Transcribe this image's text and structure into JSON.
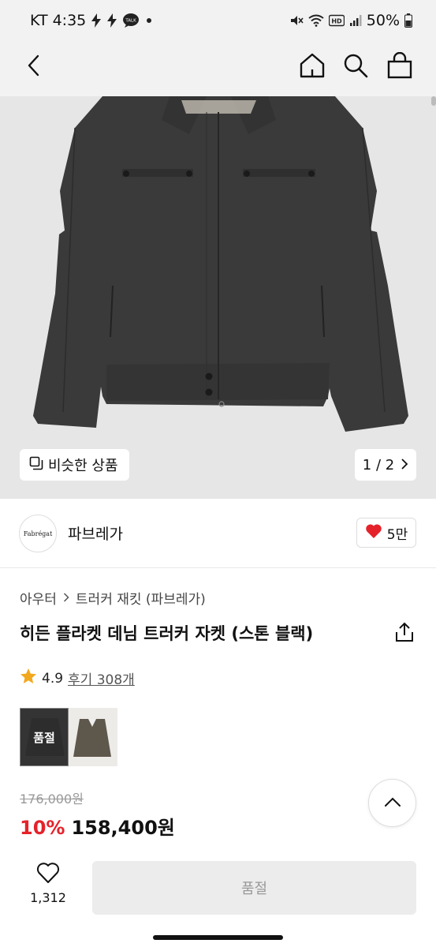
{
  "status_bar": {
    "carrier": "KT",
    "time": "4:35",
    "battery": "50%",
    "icons": [
      "bolt-icon",
      "bolt-icon",
      "talk-icon",
      "dot-icon",
      "mute-icon",
      "wifi-icon",
      "hd-icon",
      "signal-icon",
      "battery-icon"
    ]
  },
  "header": {
    "icons": [
      "back-icon",
      "home-icon",
      "search-icon",
      "cart-icon"
    ]
  },
  "gallery": {
    "similar_label": "비슷한 상품",
    "page_indicator": "1 / 2"
  },
  "brand": {
    "logo_text": "Fabrégat",
    "name": "파브레가",
    "likes": "5만"
  },
  "product": {
    "breadcrumb": [
      "아우터",
      "트러커 재킷 (파브레가)"
    ],
    "title": "히든 플라켓 데님 트러커 자켓 (스톤 블랙)",
    "rating": "4.9",
    "reviews": "후기 308개",
    "swatches": [
      {
        "label": "품절",
        "color": "#2a2a2a",
        "selected": true
      },
      {
        "label": "",
        "color": "#5e574c",
        "selected": false
      }
    ],
    "original_price": "176,000원",
    "discount": "10%",
    "price": "158,400원"
  },
  "bottom": {
    "wish_count": "1,312",
    "buy_label": "품절"
  },
  "colors": {
    "accent_red": "#e5222a",
    "header_bg": "#f2f2f2",
    "jacket": "#3a3a3a"
  }
}
